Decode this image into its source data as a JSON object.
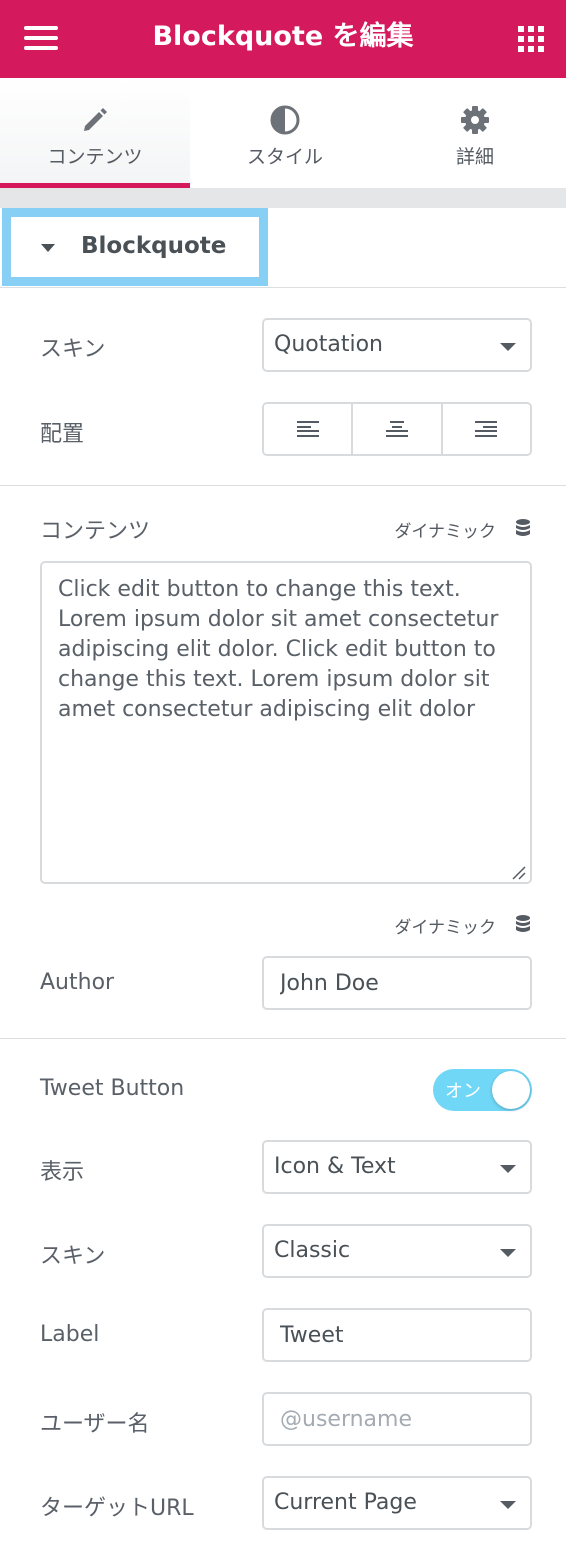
{
  "header": {
    "title": "Blockquote を編集",
    "menu_icon": "hamburger-menu-icon",
    "apps_icon": "grid-apps-icon",
    "brand_color": "#d5195d"
  },
  "tabs": [
    {
      "label": "コンテンツ",
      "icon": "pencil-icon",
      "active": true
    },
    {
      "label": "スタイル",
      "icon": "half-circle-icon",
      "active": false
    },
    {
      "label": "詳細",
      "icon": "gear-icon",
      "active": false
    }
  ],
  "section": {
    "title": "Blockquote"
  },
  "skin": {
    "label": "スキン",
    "value": "Quotation"
  },
  "alignment": {
    "label": "配置",
    "options": [
      "left",
      "center",
      "right"
    ]
  },
  "content": {
    "label": "コンテンツ",
    "dynamic_label": "ダイナミック",
    "text": "Click edit button to change this text. Lorem ipsum dolor sit amet consectetur adipiscing elit dolor. Click edit button to change this text. Lorem ipsum dolor sit amet consectetur adipiscing elit dolor"
  },
  "author": {
    "dynamic_label": "ダイナミック",
    "label": "Author",
    "value": "John Doe"
  },
  "tweet_button": {
    "label": "Tweet Button",
    "toggle_label": "オン",
    "on": true,
    "toggle_color": "#71d7f7"
  },
  "display": {
    "label": "表示",
    "value": "Icon & Text"
  },
  "tweet_skin": {
    "label": "スキン",
    "value": "Classic"
  },
  "tweet_label": {
    "label": "Label",
    "value": "Tweet"
  },
  "username": {
    "label": "ユーザー名",
    "placeholder": "@username"
  },
  "target_url": {
    "label": "ターゲットURL",
    "value": "Current Page"
  }
}
